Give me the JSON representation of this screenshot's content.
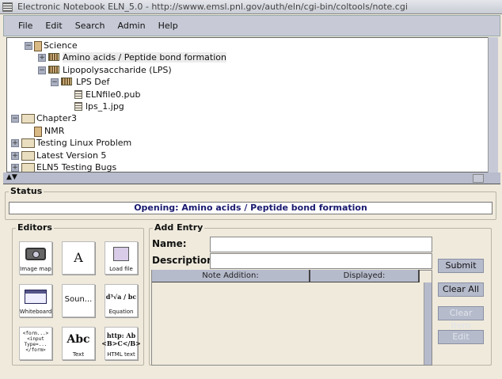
{
  "window": {
    "title": "Electronic Notebook ELN_5.0 - http://swww.emsl.pnl.gov/auth/eln/cgi-bin/coltools/note.cgi"
  },
  "menu": [
    "File",
    "Edit",
    "Search",
    "Admin",
    "Help"
  ],
  "tree": [
    {
      "label": "Science",
      "type": "doc",
      "handle": "minus"
    },
    {
      "label": "Amino acids / Peptide bond formation",
      "type": "note",
      "handle": "plus",
      "selected": true
    },
    {
      "label": "Lipopolysaccharide (LPS)",
      "type": "note",
      "handle": "minus"
    },
    {
      "label": "LPS Def",
      "type": "note",
      "handle": "minus"
    },
    {
      "label": "ELNfile0.pub",
      "type": "file"
    },
    {
      "label": "lps_1.jpg",
      "type": "file"
    },
    {
      "label": "Chapter3",
      "type": "folder",
      "handle": "minus"
    },
    {
      "label": "NMR",
      "type": "doc"
    },
    {
      "label": "Testing Linux Problem",
      "type": "folder",
      "handle": "plus"
    },
    {
      "label": "Latest Version 5",
      "type": "folder",
      "handle": "plus"
    },
    {
      "label": "ELN5 Testing Bugs",
      "type": "folder",
      "handle": "plus"
    }
  ],
  "status": {
    "title": "Status",
    "message": "Opening: Amino acids / Peptide bond formation"
  },
  "editors": {
    "title": "Editors",
    "tools": [
      {
        "label": "Image map",
        "icon": "camera-icon"
      },
      {
        "label": "",
        "icon": "A"
      },
      {
        "label": "Load file",
        "icon": "floppy-icon"
      },
      {
        "label": "Whiteboard",
        "icon": "whiteboard-icon"
      },
      {
        "label": "Soun...",
        "icon": ""
      },
      {
        "label": "Equation",
        "icon": "d³√a / bc"
      },
      {
        "label": "<form...> <input Type=... </form>",
        "icon": ""
      },
      {
        "label": "Text",
        "icon": "Abc"
      },
      {
        "label": "HTML text",
        "icon": "http: Ab <B>C</B>"
      }
    ]
  },
  "add_entry": {
    "title": "Add Entry",
    "name_label": "Name:",
    "name_value": "",
    "description_label": "Description:",
    "description_value": "",
    "columns": [
      "Note Addition:",
      "Displayed:"
    ],
    "buttons": {
      "submit": "Submit",
      "clear_all": "Clear All",
      "clear_item": "Clear Item",
      "edit": "Edit"
    }
  }
}
